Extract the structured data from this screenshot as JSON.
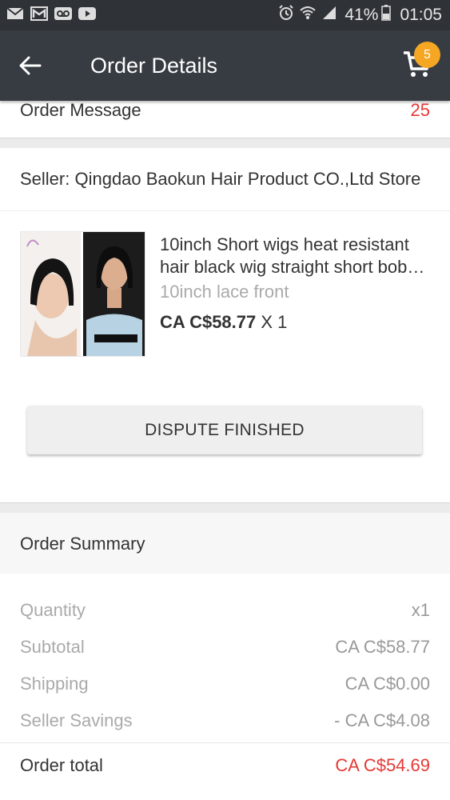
{
  "status_bar": {
    "battery": "41%",
    "time": "01:05",
    "icons_left": [
      "email-icon",
      "gmail-icon",
      "voicemail-icon",
      "youtube-icon"
    ],
    "icons_right": [
      "alarm-icon",
      "wifi-icon",
      "signal-icon",
      "battery-icon"
    ]
  },
  "app_bar": {
    "title": "Order Details",
    "cart_count": "5"
  },
  "order_message": {
    "label": "Order Message",
    "count": "25"
  },
  "seller": {
    "text": "Seller: Qingdao Baokun Hair Product CO.,Ltd Store"
  },
  "product": {
    "title": "10inch Short wigs heat resistant hair black wig straight short bob wig",
    "variant": "10inch lace front",
    "price": "CA C$58.77",
    "quantity": "X 1"
  },
  "actions": {
    "dispute_label": "DISPUTE FINISHED"
  },
  "summary": {
    "title": "Order Summary",
    "rows": [
      {
        "label": "Quantity",
        "value": "x1"
      },
      {
        "label": "Subtotal",
        "value": "CA C$58.77"
      },
      {
        "label": "Shipping",
        "value": "CA C$0.00"
      },
      {
        "label": "Seller Savings",
        "value": "- CA C$4.08"
      }
    ],
    "total_label": "Order total",
    "total_value": "CA C$54.69"
  },
  "colors": {
    "app_bar": "#373c43",
    "accent_red": "#e53935",
    "badge": "#f5a623"
  }
}
